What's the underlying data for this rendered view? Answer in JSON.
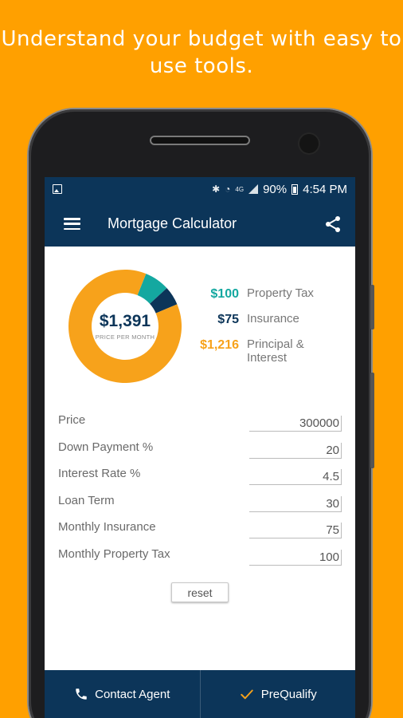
{
  "headline": "Understand your budget with easy to use tools.",
  "status_bar": {
    "battery": "90%",
    "time": "4:54 PM",
    "network": "4G"
  },
  "app_bar": {
    "title": "Mortgage Calculator",
    "menu_icon": "hamburger-menu-icon",
    "share_icon": "share-icon"
  },
  "summary": {
    "monthly_payment": "$1,391",
    "caption": "PRICE PER MONTH",
    "breakdown": [
      {
        "value": "$100",
        "label": "Property Tax",
        "color": "#14A8A0",
        "amount": 100
      },
      {
        "value": "$75",
        "label": "Insurance",
        "color": "#0C3559",
        "amount": 75
      },
      {
        "value": "$1,216",
        "label": "Principal & Interest",
        "color": "#F7A21B",
        "amount": 1216
      }
    ]
  },
  "form": {
    "fields": [
      {
        "label": "Price",
        "value": "300000"
      },
      {
        "label": "Down Payment %",
        "value": "20"
      },
      {
        "label": "Interest Rate %",
        "value": "4.5"
      },
      {
        "label": "Loan Term",
        "value": "30"
      },
      {
        "label": "Monthly Insurance",
        "value": "75"
      },
      {
        "label": "Monthly Property Tax",
        "value": "100"
      }
    ],
    "reset_label": "reset"
  },
  "bottom_bar": {
    "contact_label": "Contact Agent",
    "contact_icon": "phone-icon",
    "prequalify_label": "PreQualify",
    "prequalify_icon": "checkmark-icon"
  },
  "colors": {
    "background": "#FFA000",
    "navy": "#0C3559",
    "teal": "#14A8A0",
    "orange": "#F7A21B"
  }
}
